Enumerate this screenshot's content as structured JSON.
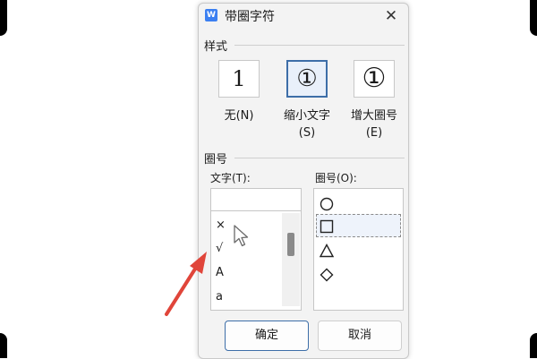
{
  "window": {
    "title": "带圈字符",
    "app_icon": "W",
    "close_icon": "close-icon"
  },
  "style_group": {
    "label": "样式",
    "options": [
      {
        "glyph": "1",
        "label": "无(N)",
        "selected": false
      },
      {
        "glyph": "①",
        "label": "缩小文字\n(S)",
        "selected": true
      },
      {
        "glyph": "①",
        "label": "增大圈号\n(E)",
        "selected": false
      }
    ]
  },
  "circle_group": {
    "label": "圈号",
    "text_label": "文字(T):",
    "text_value": "",
    "text_items": [
      "×",
      "√",
      "A",
      "a"
    ],
    "symbol_label": "圈号(O):",
    "symbols": [
      "circle-icon",
      "square-icon",
      "triangle-icon",
      "diamond-icon"
    ],
    "selected_symbol": "square-icon"
  },
  "buttons": {
    "ok": "确定",
    "cancel": "取消"
  },
  "colors": {
    "accent": "#3d6ea8",
    "arrow": "#e0453a",
    "app_icon": "#3b7ff1"
  }
}
